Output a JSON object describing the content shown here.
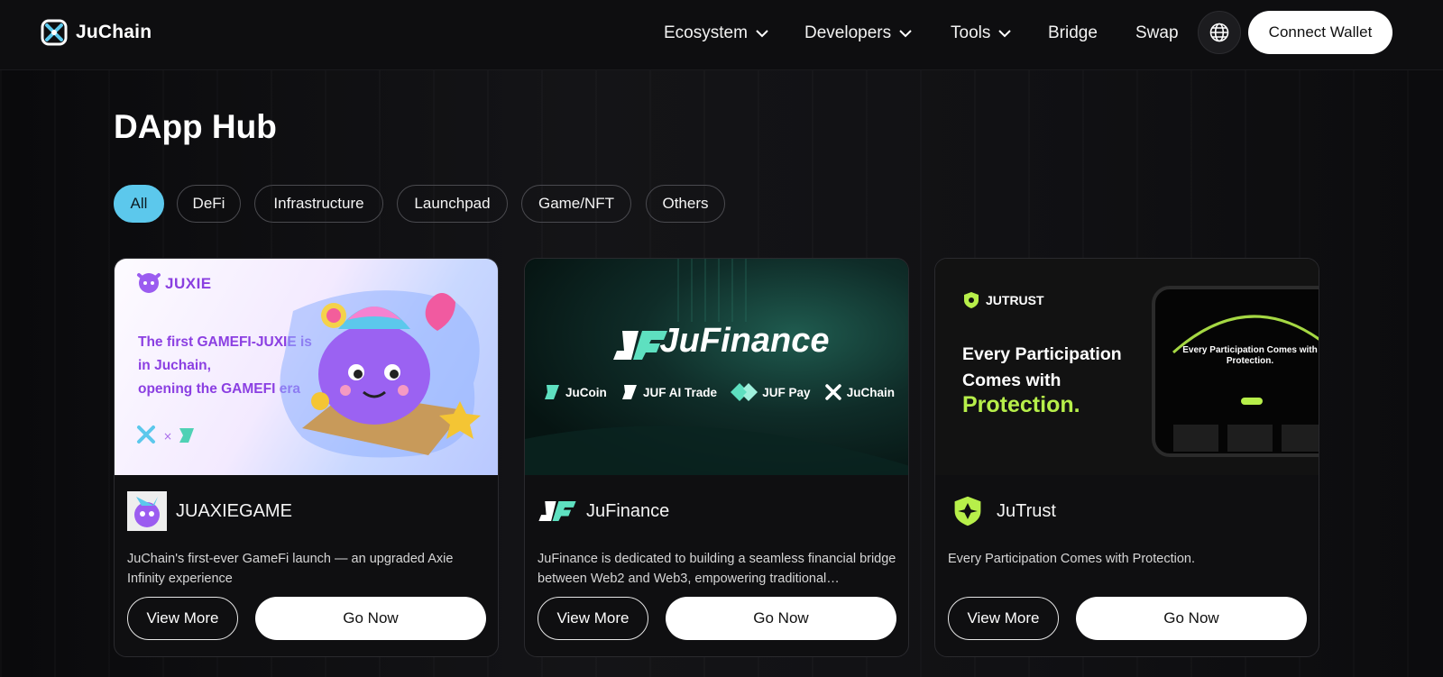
{
  "nav": {
    "brand": "JuChain",
    "links": [
      {
        "label": "Ecosystem",
        "dropdown": true
      },
      {
        "label": "Developers",
        "dropdown": true
      },
      {
        "label": "Tools",
        "dropdown": true
      },
      {
        "label": "Bridge",
        "dropdown": false
      },
      {
        "label": "Swap",
        "dropdown": false
      }
    ],
    "connect_label": "Connect Wallet"
  },
  "page": {
    "title": "DApp Hub",
    "filters": [
      "All",
      "DeFi",
      "Infrastructure",
      "Launchpad",
      "Game/NFT",
      "Others"
    ],
    "active_filter": "All"
  },
  "cards": [
    {
      "name": "JUAXIEGAME",
      "description": "JuChain's first-ever GameFi launch — an upgraded Axie Infinity experience",
      "view_label": "View More",
      "go_label": "Go Now",
      "banner": {
        "brand": "JUXIE",
        "slogan": [
          "The first GAMEFI-JUXIE is",
          "in Juchain,",
          "opening the GAMEFI era"
        ]
      }
    },
    {
      "name": "JuFinance",
      "description": "JuFinance is dedicated to building a seamless financial bridge between Web2 and Web3, empowering traditional…",
      "view_label": "View More",
      "go_label": "Go Now",
      "banner": {
        "title": "JuFinance",
        "partners": [
          "JuCoin",
          "JUF AI Trade",
          "JUF Pay",
          "JuChain"
        ]
      }
    },
    {
      "name": "JuTrust",
      "description": "Every Participation Comes with Protection.",
      "view_label": "View More",
      "go_label": "Go Now",
      "banner": {
        "brand": "JUTRUST",
        "headline": [
          "Every Participation",
          "Comes with"
        ],
        "accent": "Protection.",
        "device_text": "Every Participation Comes with Protection."
      }
    }
  ],
  "colors": {
    "accent": "#5cc8ec",
    "jutrust_green": "#b7ef4a",
    "juxie_purple": "#8b3fe2",
    "background": "#0b0b0d"
  }
}
